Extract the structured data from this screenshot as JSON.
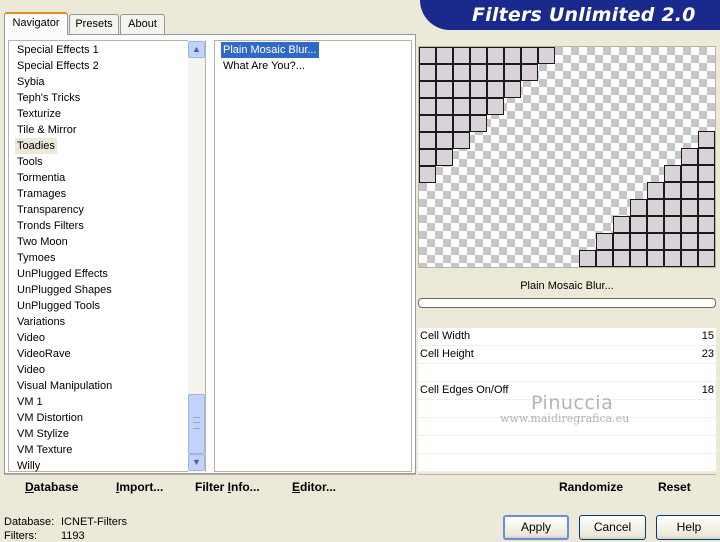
{
  "tabs": [
    "Navigator",
    "Presets",
    "About"
  ],
  "banner_title": "Filters Unlimited 2.0",
  "categories": [
    "Special Effects 1",
    "Special Effects 2",
    "Sybia",
    "Teph's Tricks",
    "Texturize",
    "Tile & Mirror",
    "Toadies",
    "Tools",
    "Tormentia",
    "Tramages",
    "Transparency",
    "Tronds Filters",
    "Two Moon",
    "Tymoes",
    "UnPlugged Effects",
    "UnPlugged Shapes",
    "UnPlugged Tools",
    "Variations",
    "Video",
    "VideoRave",
    "Video",
    "Visual Manipulation",
    "VM 1",
    "VM Distortion",
    "VM Stylize",
    "VM Texture",
    "Willy"
  ],
  "selected_category": "Toadies",
  "filters": [
    "Plain Mosaic Blur...",
    "What Are You?..."
  ],
  "selected_filter": "Plain Mosaic Blur...",
  "bottom_buttons": {
    "database": {
      "ul": "D",
      "rest": "atabase"
    },
    "import": {
      "ul": "I",
      "rest": "mport..."
    },
    "filter_info": {
      "pre": "Filter ",
      "ul": "I",
      "rest": "nfo..."
    },
    "editor": {
      "ul": "E",
      "rest": "ditor..."
    },
    "randomize": "Randomize",
    "reset": "Reset"
  },
  "preview_filter_name": "Plain Mosaic Blur...",
  "params": [
    {
      "label": "Cell Width",
      "value": "15"
    },
    {
      "label": "Cell Height",
      "value": "23"
    },
    {
      "label": "",
      "value": ""
    },
    {
      "label": "Cell Edges On/Off",
      "value": "18"
    },
    {
      "label": "",
      "value": ""
    },
    {
      "label": "",
      "value": ""
    },
    {
      "label": "",
      "value": ""
    },
    {
      "label": "",
      "value": ""
    }
  ],
  "watermark": {
    "name": "Pinuccia",
    "site": "www.maidiregrafica.eu"
  },
  "status": {
    "database_label": "Database:",
    "database_value": "ICNET-Filters",
    "filters_label": "Filters:",
    "filters_value": "1193"
  },
  "buttons": {
    "apply": "Apply",
    "cancel": "Cancel",
    "help": "Help"
  },
  "icons": {
    "scroll_up": "chevron-up-icon",
    "scroll_down": "chevron-down-icon"
  },
  "colors": {
    "banner": "#1a2a8c",
    "selection": "#316ac5",
    "tab_highlight": "#e68b2c"
  }
}
